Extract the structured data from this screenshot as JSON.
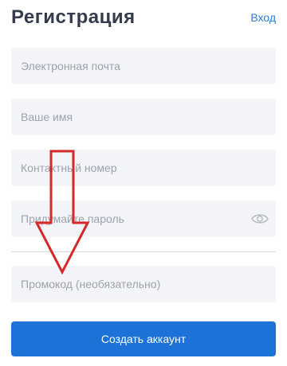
{
  "header": {
    "title": "Регистрация",
    "login_link": "Вход"
  },
  "form": {
    "email_placeholder": "Электронная почта",
    "name_placeholder": "Ваше имя",
    "phone_placeholder": "Контактный номер",
    "password_placeholder": "Придумайте пароль",
    "promo_placeholder": "Промокод (необязательно)",
    "submit_label": "Создать аккаунт"
  },
  "icons": {
    "password_toggle": "eye-icon",
    "annotation": "red-down-arrow"
  },
  "colors": {
    "accent": "#1d72d7",
    "link": "#2a7ad7",
    "field_background": "#f3f4f7",
    "annotation_arrow": "#d62828"
  }
}
